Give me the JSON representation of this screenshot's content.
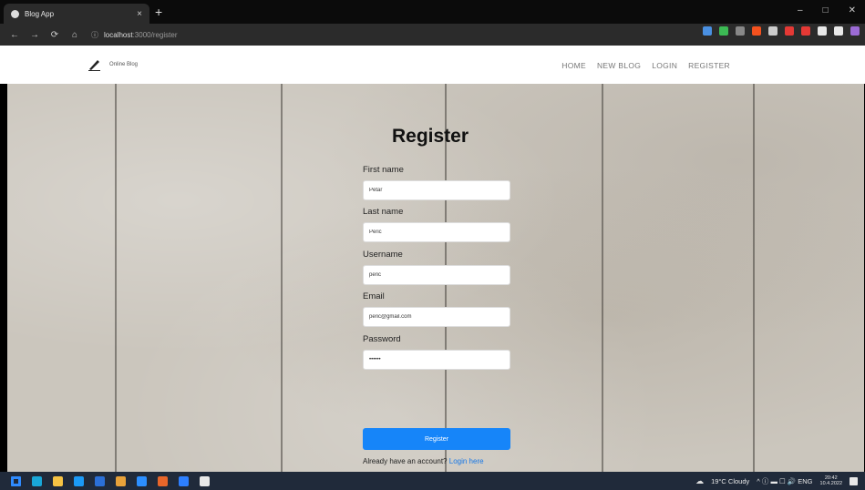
{
  "browser": {
    "tab_title": "Blog App",
    "tab_close": "×",
    "new_tab": "+",
    "window_controls": [
      "–",
      "□",
      "✕"
    ],
    "nav_buttons": [
      "←",
      "→",
      "⟳",
      "⌂"
    ],
    "url_host": "localhost",
    "url_path": ":3000/register",
    "extension_colors": [
      "#4a90e2",
      "#3cba54",
      "#888888",
      "#f4511e",
      "#cccccc",
      "#e53935",
      "#e53935",
      "#e8e8e8",
      "#e8e8e8",
      "#9c6bd6"
    ]
  },
  "site": {
    "brand_icon": "pen-icon",
    "brand_name": "Online Blog",
    "nav": [
      {
        "label": "HOME"
      },
      {
        "label": "NEW BLOG"
      },
      {
        "label": "LOGIN"
      },
      {
        "label": "REGISTER"
      }
    ]
  },
  "register": {
    "heading": "Register",
    "first_name_label": "First name",
    "first_name_value": "Petar",
    "last_name_label": "Last name",
    "last_name_value": "Peric",
    "username_label": "Username",
    "username_value": "peric",
    "email_label": "Email",
    "email_value": "peric@gmail.com",
    "password_label": "Password",
    "password_value": "••••••",
    "submit_label": "Register",
    "already_text": "Already have an account?",
    "login_link": "Login here"
  },
  "taskbar": {
    "app_icon_colors": [
      "#2f8bff",
      "#19a7d8",
      "#f6c344",
      "#1b9af7",
      "#2b6fd6",
      "#e8a23a",
      "#2c8fff",
      "#e8662a",
      "#2d7fff",
      "#e8e8e8"
    ],
    "weather": "19°C Cloudy",
    "tray_symbols": "^ ⓘ ▬ ☐ 🔊 ENG",
    "time": "20:42",
    "date": "10.4.2022"
  },
  "colors": {
    "primary_button": "#1685f9",
    "link": "#1677e6"
  }
}
